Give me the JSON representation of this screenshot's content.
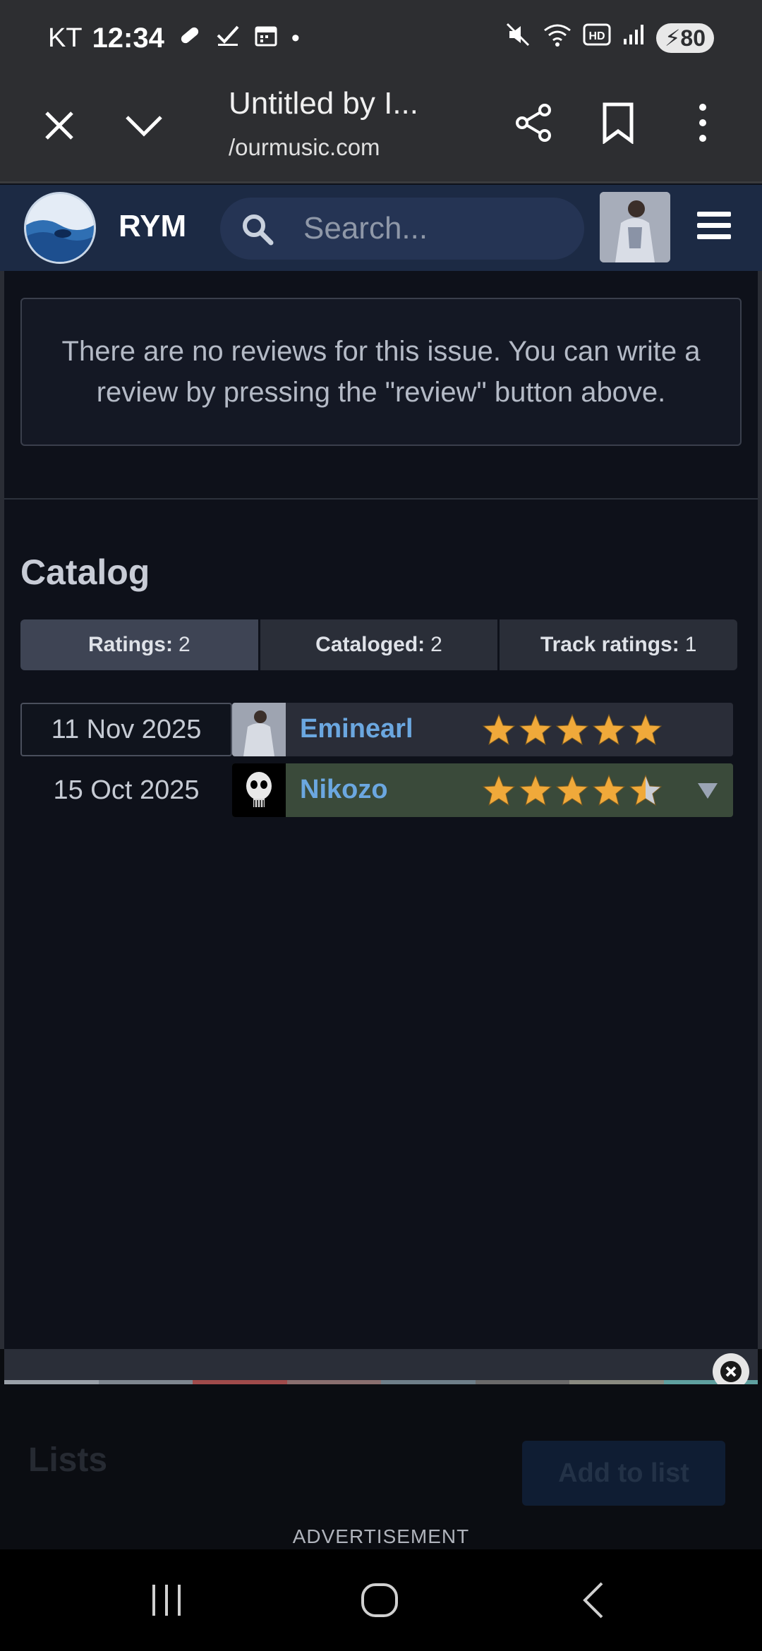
{
  "status_bar": {
    "carrier": "KT",
    "time": "12:34",
    "battery": "80",
    "dot": "•"
  },
  "browser": {
    "page_title": "Untitled by I...",
    "url": "/ourmusic.com"
  },
  "site_header": {
    "brand": "RYM",
    "search_placeholder": "Search..."
  },
  "reviews": {
    "empty_notice": "There are no reviews for this issue. You can write a review by pressing the \"review\" button above."
  },
  "catalog": {
    "title": "Catalog",
    "tabs": [
      {
        "label": "Ratings:",
        "count": "2"
      },
      {
        "label": "Cataloged:",
        "count": "2"
      },
      {
        "label": "Track ratings:",
        "count": "1"
      }
    ],
    "rows": [
      {
        "date": "11 Nov 2025",
        "user": "Eminearl",
        "rating": 5
      },
      {
        "date": "15 Oct 2025",
        "user": "Nikozo",
        "rating": 4.5
      }
    ]
  },
  "lists": {
    "title": "Lists",
    "add_button": "Add to list"
  },
  "ad": {
    "label": "ADVERTISEMENT"
  },
  "colors": {
    "link": "#6ba7e0",
    "star": "#f0a93a",
    "header_bg": "#1c2a44"
  }
}
